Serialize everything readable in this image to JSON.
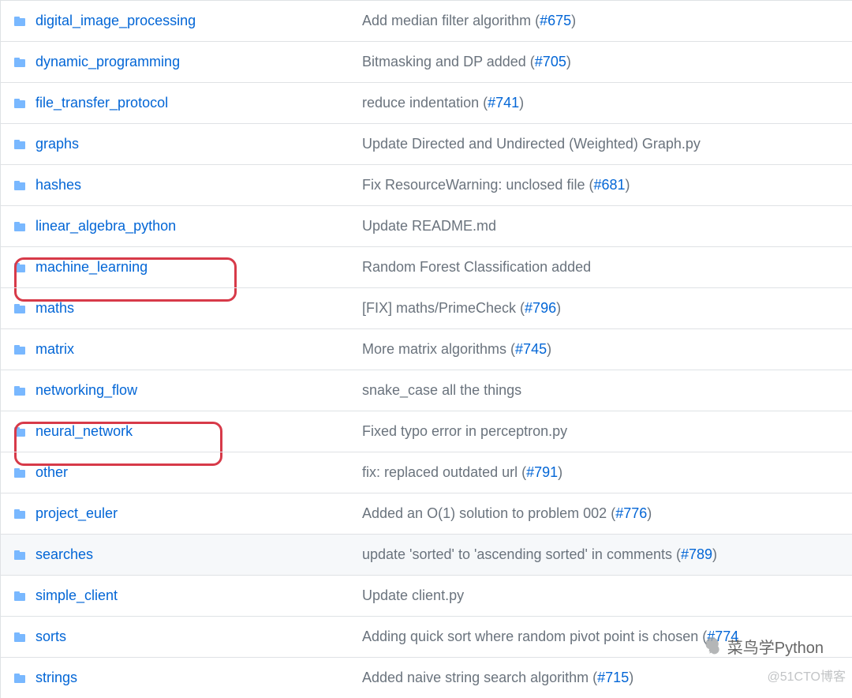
{
  "rows": [
    {
      "folder": "digital_image_processing",
      "commit_text": "Add median filter algorithm (",
      "pr": "#675",
      "commit_after": ")",
      "hover": false,
      "highlight": false
    },
    {
      "folder": "dynamic_programming",
      "commit_text": "Bitmasking and DP added (",
      "pr": "#705",
      "commit_after": ")",
      "hover": false,
      "highlight": false
    },
    {
      "folder": "file_transfer_protocol",
      "commit_text": "reduce indentation (",
      "pr": "#741",
      "commit_after": ")",
      "hover": false,
      "highlight": false
    },
    {
      "folder": "graphs",
      "commit_text": "Update Directed and Undirected (Weighted) Graph.py",
      "pr": null,
      "commit_after": "",
      "hover": false,
      "highlight": false
    },
    {
      "folder": "hashes",
      "commit_text": "Fix ResourceWarning: unclosed file (",
      "pr": "#681",
      "commit_after": ")",
      "hover": false,
      "highlight": false
    },
    {
      "folder": "linear_algebra_python",
      "commit_text": "Update README.md",
      "pr": null,
      "commit_after": "",
      "hover": false,
      "highlight": false
    },
    {
      "folder": "machine_learning",
      "commit_text": "Random Forest Classification added",
      "pr": null,
      "commit_after": "",
      "hover": false,
      "highlight": true,
      "highlightWidth": 282
    },
    {
      "folder": "maths",
      "commit_text": "[FIX] maths/PrimeCheck (",
      "pr": "#796",
      "commit_after": ")",
      "hover": false,
      "highlight": false
    },
    {
      "folder": "matrix",
      "commit_text": "More matrix algorithms (",
      "pr": "#745",
      "commit_after": ")",
      "hover": false,
      "highlight": false
    },
    {
      "folder": "networking_flow",
      "commit_text": "snake_case all the things",
      "pr": null,
      "commit_after": "",
      "hover": false,
      "highlight": false
    },
    {
      "folder": "neural_network",
      "commit_text": "Fixed typo error in perceptron.py",
      "pr": null,
      "commit_after": "",
      "hover": false,
      "highlight": true,
      "highlightWidth": 264
    },
    {
      "folder": "other",
      "commit_text": "fix: replaced outdated url (",
      "pr": "#791",
      "commit_after": ")",
      "hover": false,
      "highlight": false
    },
    {
      "folder": "project_euler",
      "commit_text": "Added an O(1) solution to problem 002 (",
      "pr": "#776",
      "commit_after": ")",
      "hover": false,
      "highlight": false
    },
    {
      "folder": "searches",
      "commit_text": "update 'sorted' to 'ascending sorted' in comments (",
      "pr": "#789",
      "commit_after": ")",
      "hover": true,
      "highlight": false
    },
    {
      "folder": "simple_client",
      "commit_text": "Update client.py",
      "pr": null,
      "commit_after": "",
      "hover": false,
      "highlight": false
    },
    {
      "folder": "sorts",
      "commit_text": "Adding quick sort where random pivot point is chosen (",
      "pr": "#774",
      "commit_after": "",
      "hover": false,
      "highlight": false
    },
    {
      "folder": "strings",
      "commit_text": "Added naive string search algorithm (",
      "pr": "#715",
      "commit_after": ")",
      "hover": false,
      "highlight": false
    }
  ],
  "watermarks": {
    "chat": "菜鸟学Python",
    "blog": "@51CTO博客"
  }
}
